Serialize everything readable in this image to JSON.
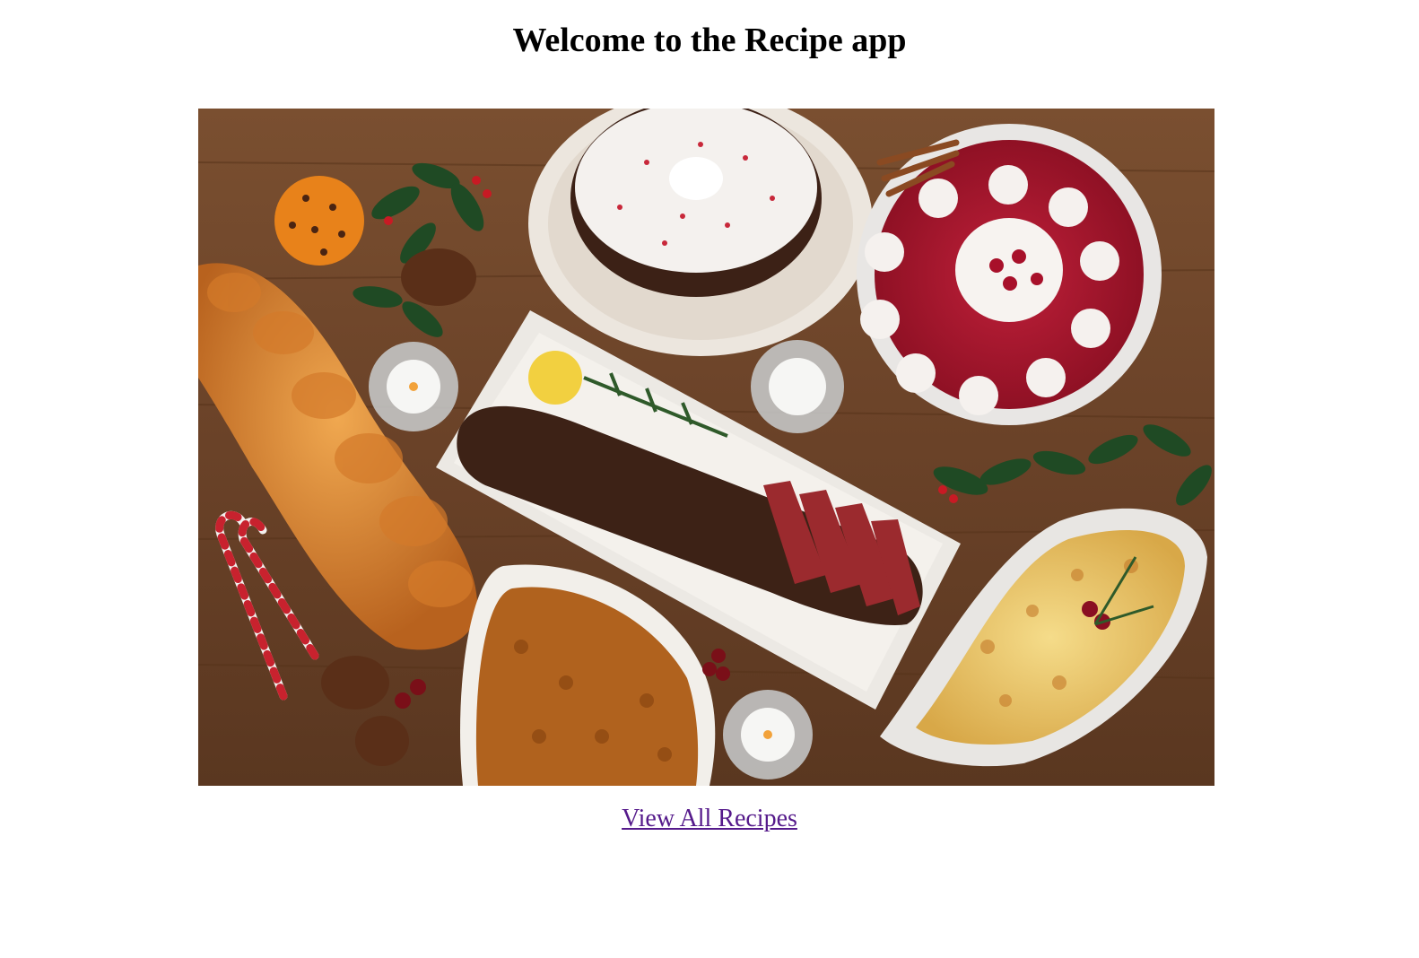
{
  "page": {
    "heading": "Welcome to the Recipe app",
    "link_label": "View All Recipes"
  },
  "hero_image": {
    "alt": "Holiday table with recipes",
    "content": [
      "bundt-cake",
      "cranberry-dessert",
      "braided-bread",
      "pepper-crusted-beef-tenderloin",
      "green-bean-casserole",
      "potato-gratin",
      "candles",
      "candy-canes",
      "holly",
      "orange-pomander",
      "cinnamon-sticks",
      "pinecones"
    ]
  },
  "colors": {
    "link": "#551a8b",
    "wood": "#6b4429",
    "text": "#000000"
  }
}
